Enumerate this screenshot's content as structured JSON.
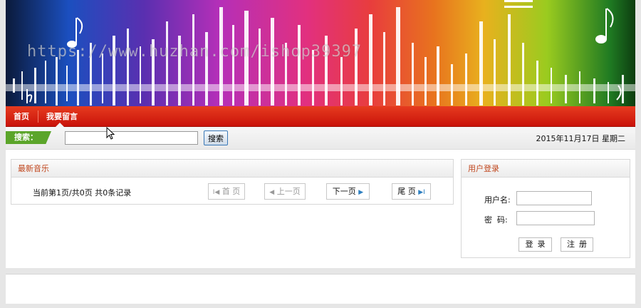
{
  "banner": {
    "watermark": "https://www.huzhan.com/ishop39397"
  },
  "nav": {
    "items": [
      {
        "label": "首页"
      },
      {
        "label": "我要留言"
      }
    ]
  },
  "search": {
    "tag_label": "搜索：",
    "input_value": "",
    "button_label": "搜索",
    "date": "2015年11月17日  星期二"
  },
  "music_panel": {
    "title": "最新音乐",
    "pager_info": "当前第1页/共0页  共0条记录",
    "first": "首 页",
    "prev": "上一页",
    "next": "下一页",
    "last": "尾 页",
    "arrows": {
      "first": "I◀",
      "prev": "◀",
      "next": "▶",
      "last": "▶I"
    }
  },
  "login_panel": {
    "title": "用户登录",
    "username_label": "用户名:",
    "password_label": "密  码:",
    "login_button": "登录",
    "register_button": "注册"
  },
  "colors": {
    "nav_red": "#d6200f",
    "search_tag_green": "#5ba52a",
    "panel_title": "#c0461d"
  }
}
